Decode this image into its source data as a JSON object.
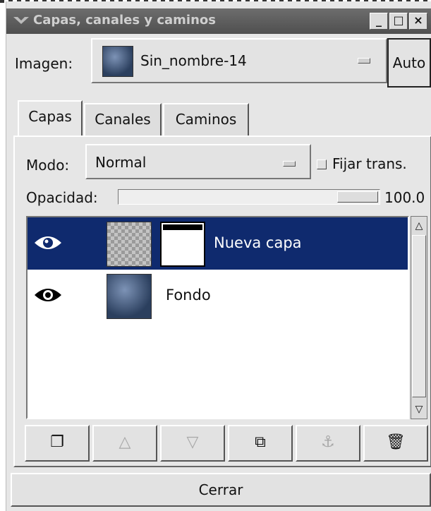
{
  "window": {
    "title": "Capas, canales y caminos",
    "min_label": "_",
    "max_label": "□",
    "close_label": "×"
  },
  "image": {
    "label": "Imagen:",
    "selected": "Sin_nombre-14",
    "auto_label": "Auto"
  },
  "tabs": [
    {
      "label": "Capas",
      "active": true
    },
    {
      "label": "Canales",
      "active": false
    },
    {
      "label": "Caminos",
      "active": false
    }
  ],
  "layers_panel": {
    "mode_label": "Modo:",
    "mode_value": "Normal",
    "lock_label": "Fijar trans.",
    "lock_checked": false,
    "opacity_label": "Opacidad:",
    "opacity_value": "100.0",
    "layers": [
      {
        "name": "Nueva capa",
        "visible": true,
        "selected": true
      },
      {
        "name": "Fondo",
        "visible": true,
        "selected": false
      }
    ],
    "buttons": [
      {
        "name": "new-layer",
        "icon": "new-layer-icon",
        "glyph": "❐",
        "enabled": true
      },
      {
        "name": "raise-layer",
        "icon": "raise-icon",
        "glyph": "△",
        "enabled": false
      },
      {
        "name": "lower-layer",
        "icon": "lower-icon",
        "glyph": "▽",
        "enabled": false
      },
      {
        "name": "duplicate-layer",
        "icon": "duplicate-icon",
        "glyph": "⧉",
        "enabled": true
      },
      {
        "name": "anchor-layer",
        "icon": "anchor-icon",
        "glyph": "⚓",
        "enabled": false
      },
      {
        "name": "delete-layer",
        "icon": "trash-icon",
        "glyph": "🗑",
        "enabled": true
      }
    ]
  },
  "footer": {
    "close_label": "Cerrar"
  },
  "colors": {
    "selection": "#0f2a6e",
    "titlebar": "#5a5a5a",
    "panel": "#e6e6e6"
  }
}
